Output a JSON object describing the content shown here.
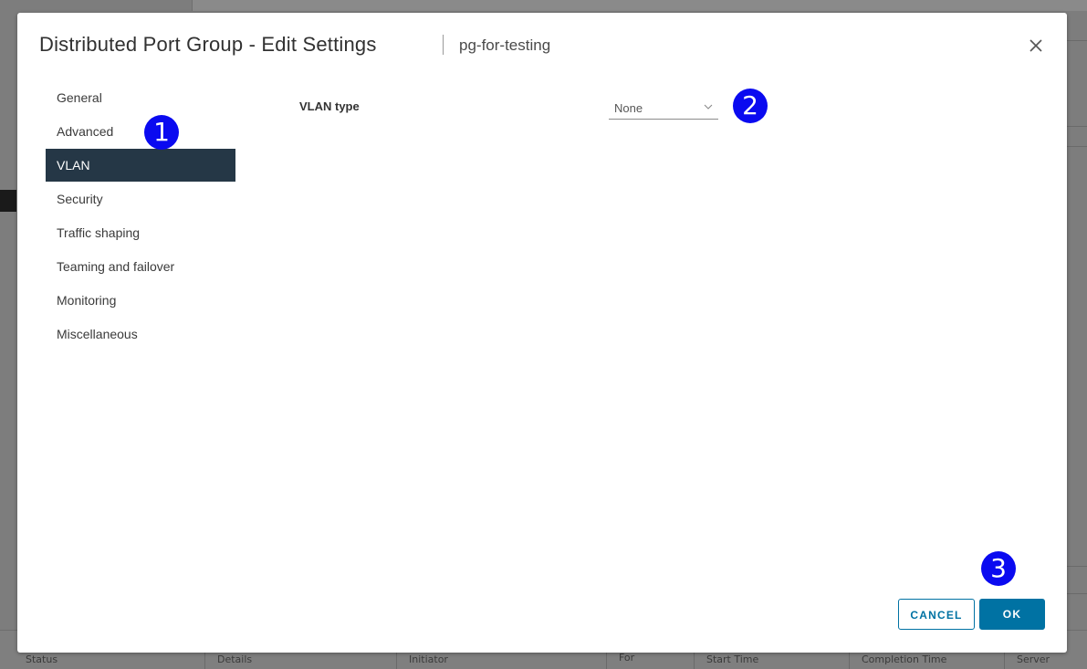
{
  "background": {
    "columns": [
      "Status",
      "Details",
      "Initiator",
      "For",
      "Start Time",
      "Completion Time",
      "Server"
    ]
  },
  "modal": {
    "title": "Distributed Port Group - Edit Settings",
    "subtitle": "pg-for-testing",
    "close_icon": "close-icon"
  },
  "sidebar": {
    "items": [
      {
        "label": "General",
        "active": false
      },
      {
        "label": "Advanced",
        "active": false
      },
      {
        "label": "VLAN",
        "active": true
      },
      {
        "label": "Security",
        "active": false
      },
      {
        "label": "Traffic shaping",
        "active": false
      },
      {
        "label": "Teaming and failover",
        "active": false
      },
      {
        "label": "Monitoring",
        "active": false
      },
      {
        "label": "Miscellaneous",
        "active": false
      }
    ]
  },
  "vlan": {
    "type_label": "VLAN type",
    "type_value": "None"
  },
  "markers": [
    "1",
    "2",
    "3"
  ],
  "footer": {
    "cancel_label": "CANCEL",
    "ok_label": "OK"
  },
  "colors": {
    "accent": "#0072a3",
    "nav_active": "#253746",
    "marker": "#0a0af0"
  }
}
